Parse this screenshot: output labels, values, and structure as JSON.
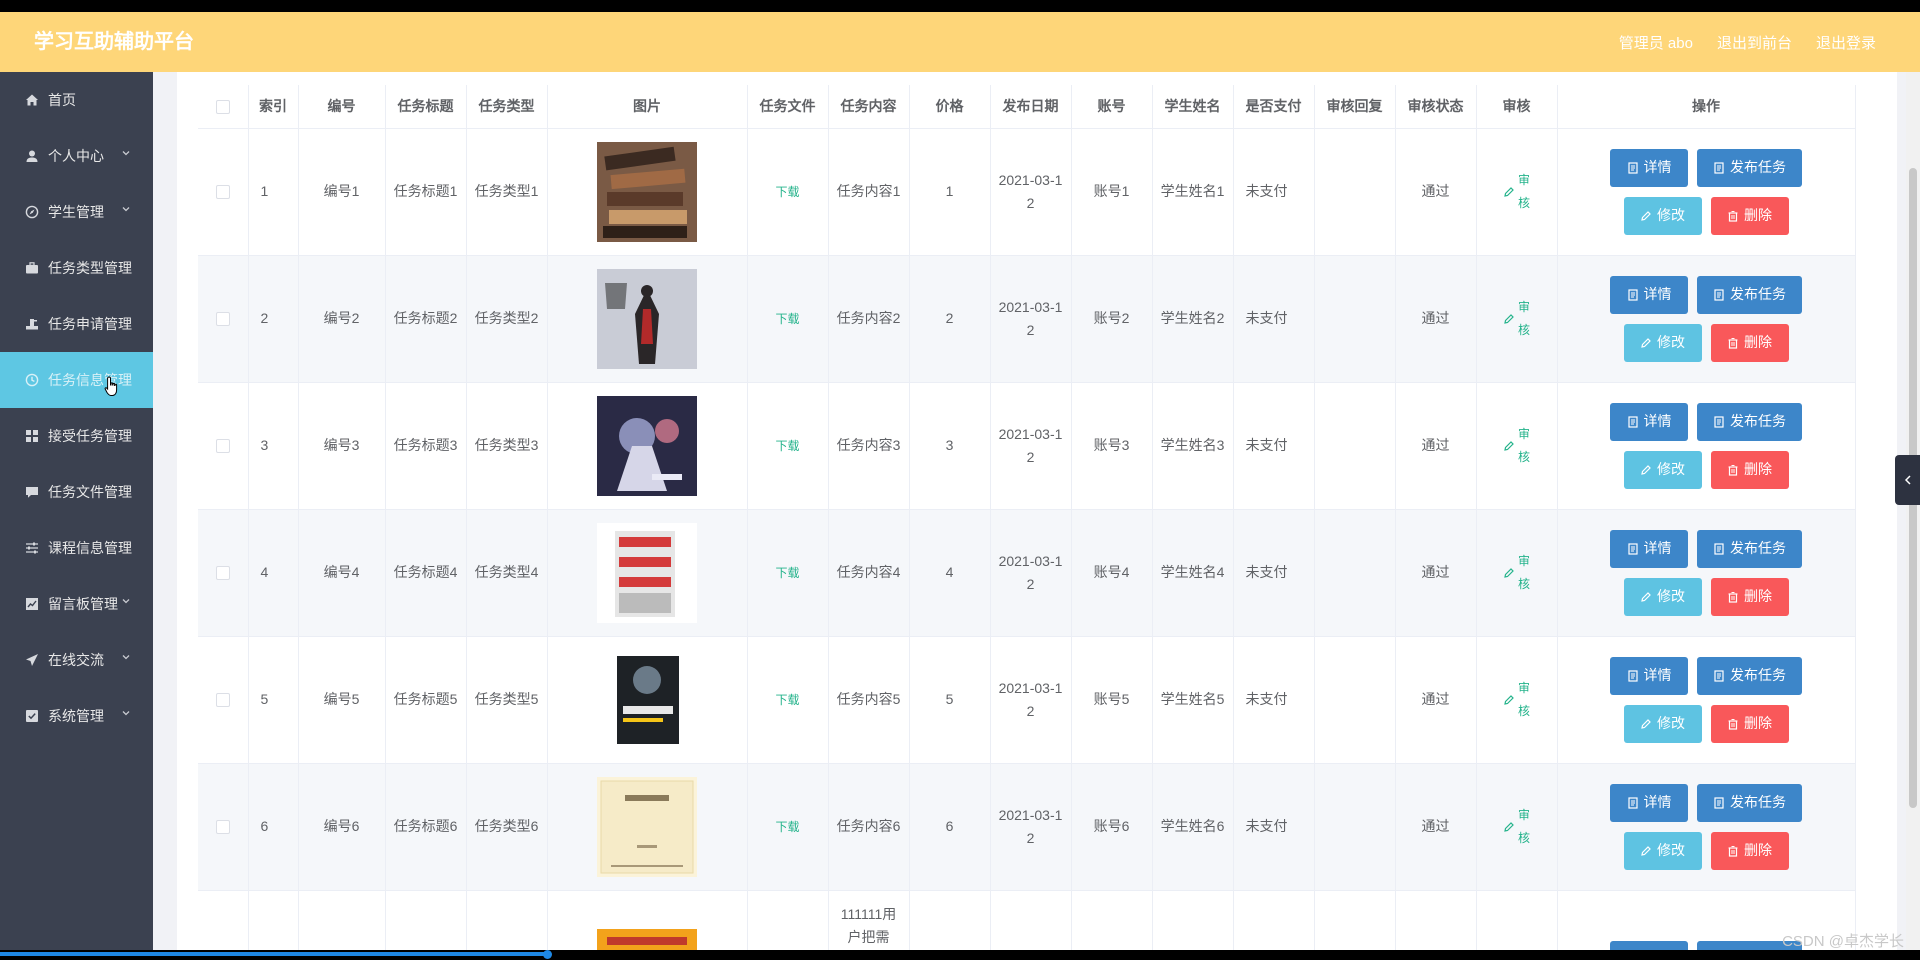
{
  "header": {
    "title": "学习互助辅助平台",
    "admin_label": "管理员 abo",
    "back_label": "退出到前台",
    "logout_label": "退出登录"
  },
  "sidebar": {
    "items": [
      {
        "label": "首页",
        "icon": "home-icon",
        "chevron": false,
        "active": false
      },
      {
        "label": "个人中心",
        "icon": "user-icon",
        "chevron": true,
        "active": false
      },
      {
        "label": "学生管理",
        "icon": "compass-icon",
        "chevron": true,
        "active": false
      },
      {
        "label": "任务类型管理",
        "icon": "briefcase-icon",
        "chevron": false,
        "active": false
      },
      {
        "label": "任务申请管理",
        "icon": "stamp-icon",
        "chevron": false,
        "active": false
      },
      {
        "label": "任务信息管理",
        "icon": "clock-icon",
        "chevron": false,
        "active": true
      },
      {
        "label": "接受任务管理",
        "icon": "grid-icon",
        "chevron": false,
        "active": false
      },
      {
        "label": "任务文件管理",
        "icon": "chat-icon",
        "chevron": false,
        "active": false
      },
      {
        "label": "课程信息管理",
        "icon": "sliders-icon",
        "chevron": false,
        "active": false
      },
      {
        "label": "留言板管理",
        "icon": "chart-icon",
        "chevron": true,
        "active": false
      },
      {
        "label": "在线交流",
        "icon": "send-icon",
        "chevron": true,
        "active": false
      },
      {
        "label": "系统管理",
        "icon": "check-square-icon",
        "chevron": true,
        "active": false
      }
    ]
  },
  "table": {
    "columns": [
      "索引",
      "编号",
      "任务标题",
      "任务类型",
      "图片",
      "任务文件",
      "任务内容",
      "价格",
      "发布日期",
      "账号",
      "学生姓名",
      "是否支付",
      "审核回复",
      "审核状态",
      "审核",
      "操作"
    ],
    "download_label": "下载",
    "audit_label": "审核",
    "buttons": {
      "detail": "详情",
      "publish": "发布任务",
      "edit": "修改",
      "delete": "删除"
    },
    "rows": [
      {
        "index": "1",
        "code": "编号1",
        "title": "任务标题1",
        "type": "任务类型1",
        "content": "任务内容1",
        "price": "1",
        "date": "2021-03-12",
        "account": "账号1",
        "student": "学生姓名1",
        "paid": "未支付",
        "reply": "",
        "status": "通过"
      },
      {
        "index": "2",
        "code": "编号2",
        "title": "任务标题2",
        "type": "任务类型2",
        "content": "任务内容2",
        "price": "2",
        "date": "2021-03-12",
        "account": "账号2",
        "student": "学生姓名2",
        "paid": "未支付",
        "reply": "",
        "status": "通过"
      },
      {
        "index": "3",
        "code": "编号3",
        "title": "任务标题3",
        "type": "任务类型3",
        "content": "任务内容3",
        "price": "3",
        "date": "2021-03-12",
        "account": "账号3",
        "student": "学生姓名3",
        "paid": "未支付",
        "reply": "",
        "status": "通过"
      },
      {
        "index": "4",
        "code": "编号4",
        "title": "任务标题4",
        "type": "任务类型4",
        "content": "任务内容4",
        "price": "4",
        "date": "2021-03-12",
        "account": "账号4",
        "student": "学生姓名4",
        "paid": "未支付",
        "reply": "",
        "status": "通过"
      },
      {
        "index": "5",
        "code": "编号5",
        "title": "任务标题5",
        "type": "任务类型5",
        "content": "任务内容5",
        "price": "5",
        "date": "2021-03-12",
        "account": "账号5",
        "student": "学生姓名5",
        "paid": "未支付",
        "reply": "",
        "status": "通过"
      },
      {
        "index": "6",
        "code": "编号6",
        "title": "任务标题6",
        "type": "任务类型6",
        "content": "任务内容6",
        "price": "6",
        "date": "2021-03-12",
        "account": "账号6",
        "student": "学生姓名6",
        "paid": "未支付",
        "reply": "",
        "status": "通过"
      }
    ],
    "partial_row_content": "111111用户把需"
  },
  "watermark": "CSDN @卓杰学长",
  "colors": {
    "header": "#fed679",
    "sidebar": "#3b4150",
    "active": "#5ec7e3",
    "primary": "#3d86c9",
    "info": "#5ec3e2",
    "danger": "#f9585a",
    "success": "#24b38b"
  }
}
